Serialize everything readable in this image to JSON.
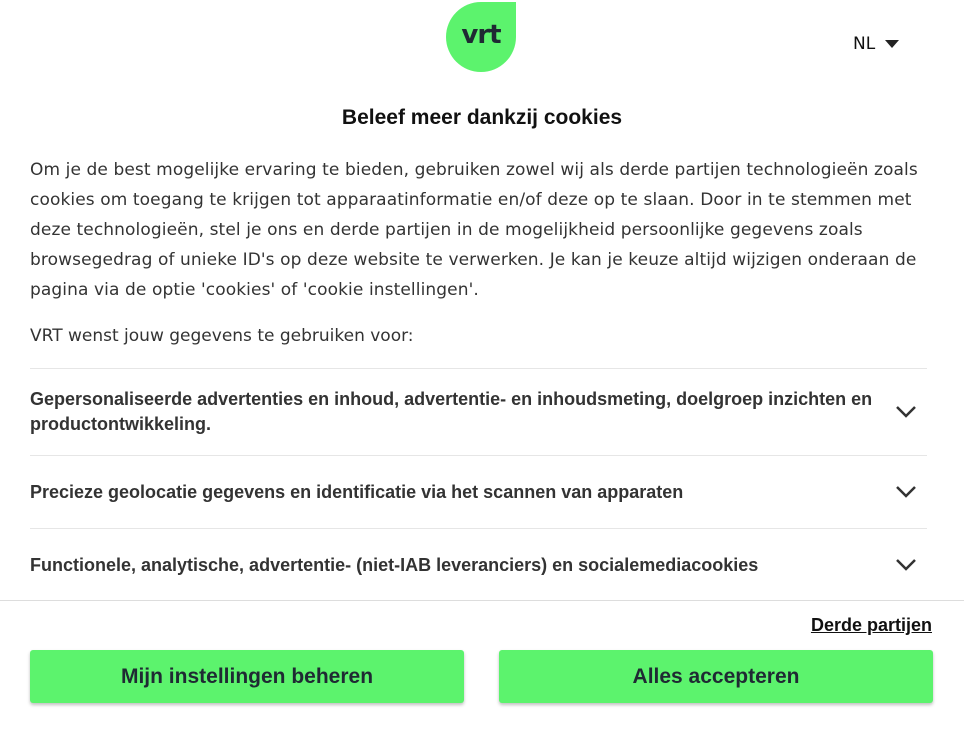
{
  "brand": {
    "logo_text": "vrt",
    "accent": "#5cf36d"
  },
  "language": {
    "selected": "NL"
  },
  "dialog": {
    "title": "Beleef meer dankzij cookies",
    "intro": "Om je de best mogelijke ervaring te bieden, gebruiken zowel wij als derde partijen technologieën zoals cookies om toegang te krijgen tot apparaatinformatie en/of deze op te slaan. Door in te stemmen met deze technologieën, stel je ons en derde partijen in de mogelijkheid persoonlijke gegevens zoals browsegedrag of unieke ID's op deze website te verwerken. Je kan je keuze altijd wijzigen onderaan de pagina via de optie 'cookies' of 'cookie instellingen'.",
    "purposes_lead": "VRT wenst jouw gegevens te gebruiken voor:",
    "purposes": [
      {
        "label": "Gepersonaliseerde advertenties en inhoud, advertentie- en inhoudsmeting, doelgroep inzichten en productontwikkeling."
      },
      {
        "label": "Precieze geolocatie gegevens en identificatie via het scannen van apparaten"
      },
      {
        "label": "Functionele, analytische, advertentie- (niet-IAB leveranciers) en socialemediacookies"
      }
    ],
    "third_parties_link": "Derde partijen",
    "buttons": {
      "manage": "Mijn instellingen beheren",
      "accept": "Alles accepteren"
    }
  }
}
